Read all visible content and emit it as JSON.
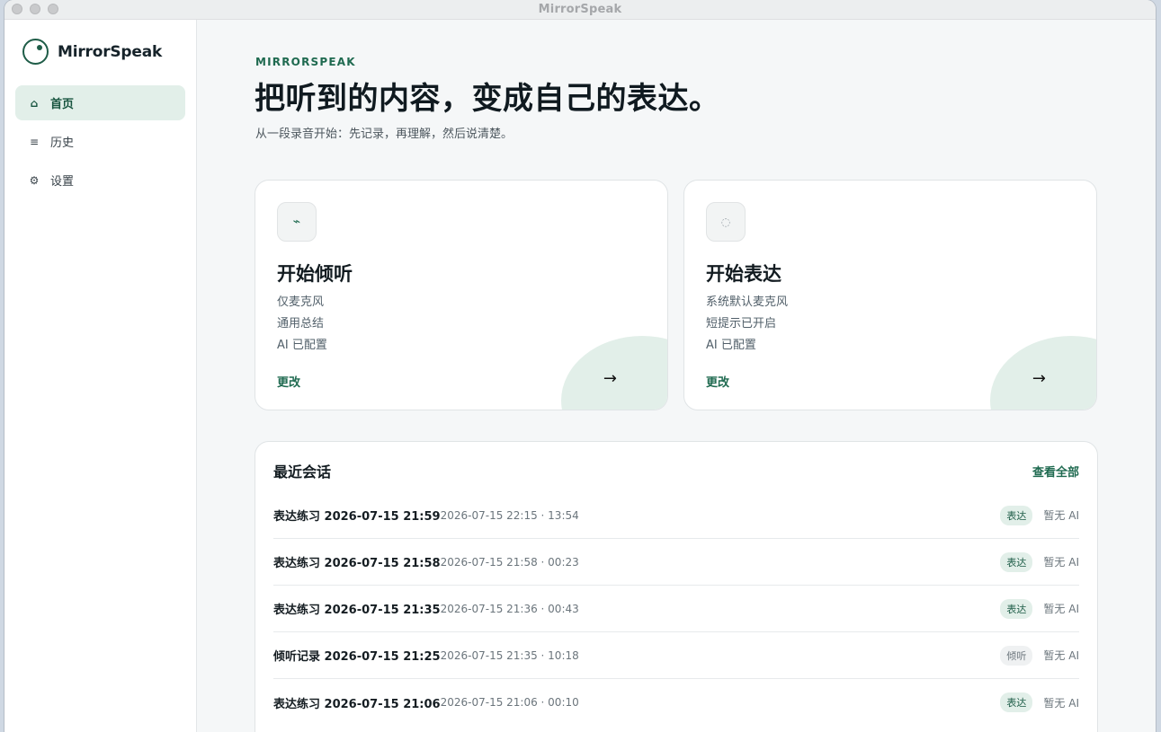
{
  "window": {
    "title": "MirrorSpeak"
  },
  "sidebar": {
    "brand": "MirrorSpeak",
    "items": [
      {
        "icon": "home-icon",
        "glyph": "⌂",
        "label": "首页"
      },
      {
        "icon": "list-icon",
        "glyph": "≡",
        "label": "历史"
      },
      {
        "icon": "gear-icon",
        "glyph": "⚙",
        "label": "设置"
      }
    ]
  },
  "hero": {
    "eyebrow": "MIRRORSPEAK",
    "headline": "把听到的内容，变成自己的表达。",
    "subline": "从一段录音开始：先记录，再理解，然后说清楚。"
  },
  "cards": [
    {
      "title": "开始倾听",
      "lines": [
        "仅麦克风",
        "通用总结",
        "AI 已配置"
      ],
      "change": "更改"
    },
    {
      "title": "开始表达",
      "lines": [
        "系统默认麦克风",
        "短提示已开启",
        "AI 已配置"
      ],
      "change": "更改"
    }
  ],
  "recent": {
    "title": "最近会话",
    "view_all": "查看全部",
    "rows": [
      {
        "name": "表达练习 2026-07-15 21:59",
        "meta": "2026-07-15 22:15 · 13:54",
        "tag": "表达",
        "ai": "暂无 AI"
      },
      {
        "name": "表达练习 2026-07-15 21:58",
        "meta": "2026-07-15 21:58 · 00:23",
        "tag": "表达",
        "ai": "暂无 AI"
      },
      {
        "name": "表达练习 2026-07-15 21:35",
        "meta": "2026-07-15 21:36 · 00:43",
        "tag": "表达",
        "ai": "暂无 AI"
      },
      {
        "name": "倾听记录 2026-07-15 21:25",
        "meta": "2026-07-15 21:35 · 10:18",
        "tag": "倾听",
        "ai": "暂无 AI"
      },
      {
        "name": "表达练习 2026-07-15 21:06",
        "meta": "2026-07-15 21:06 · 00:10",
        "tag": "表达",
        "ai": "暂无 AI"
      }
    ]
  }
}
